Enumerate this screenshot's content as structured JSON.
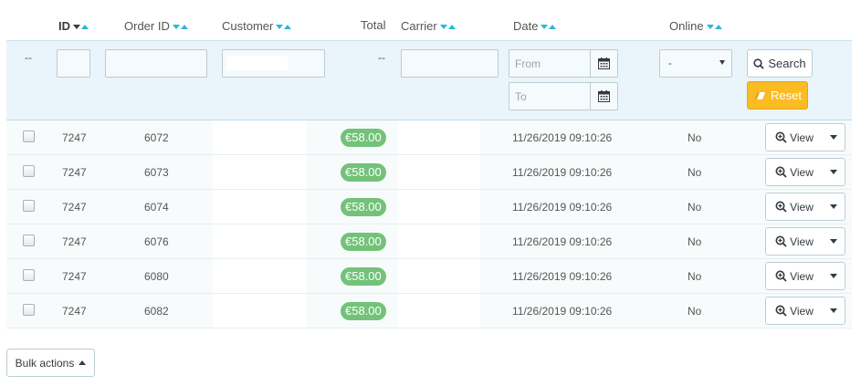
{
  "header": {
    "id": "ID",
    "order_id": "Order ID",
    "customer": "Customer",
    "total": "Total",
    "carrier": "Carrier",
    "date": "Date",
    "online": "Online"
  },
  "filters": {
    "dash": "--",
    "total_dash": "--",
    "id_value": "",
    "order_id_value": "",
    "customer_value": "",
    "carrier_value": "",
    "date_from_placeholder": "From",
    "date_to_placeholder": "To",
    "online_selected": "-",
    "search_label": "Search",
    "reset_label": "Reset"
  },
  "rows": [
    {
      "id": "7247",
      "order_id": "6072",
      "total": "€58.00",
      "date": "11/26/2019 09:10:26",
      "online": "No",
      "action": "View"
    },
    {
      "id": "7247",
      "order_id": "6073",
      "total": "€58.00",
      "date": "11/26/2019 09:10:26",
      "online": "No",
      "action": "View"
    },
    {
      "id": "7247",
      "order_id": "6074",
      "total": "€58.00",
      "date": "11/26/2019 09:10:26",
      "online": "No",
      "action": "View"
    },
    {
      "id": "7247",
      "order_id": "6076",
      "total": "€58.00",
      "date": "11/26/2019 09:10:26",
      "online": "No",
      "action": "View"
    },
    {
      "id": "7247",
      "order_id": "6080",
      "total": "€58.00",
      "date": "11/26/2019 09:10:26",
      "online": "No",
      "action": "View"
    },
    {
      "id": "7247",
      "order_id": "6082",
      "total": "€58.00",
      "date": "11/26/2019 09:10:26",
      "online": "No",
      "action": "View"
    }
  ],
  "footer": {
    "bulk_actions": "Bulk actions"
  },
  "colors": {
    "accent": "#25b9d7",
    "badge_green": "#72c279",
    "reset_yellow": "#fbbb22",
    "filter_bg": "#eaf4fb"
  },
  "icons": {
    "sort": "sort-desc-asc-icon",
    "calendar": "calendar-icon",
    "search": "magnifier-icon",
    "reset": "eraser-icon",
    "view": "zoom-in-icon",
    "dropdown": "caret-down-icon"
  }
}
